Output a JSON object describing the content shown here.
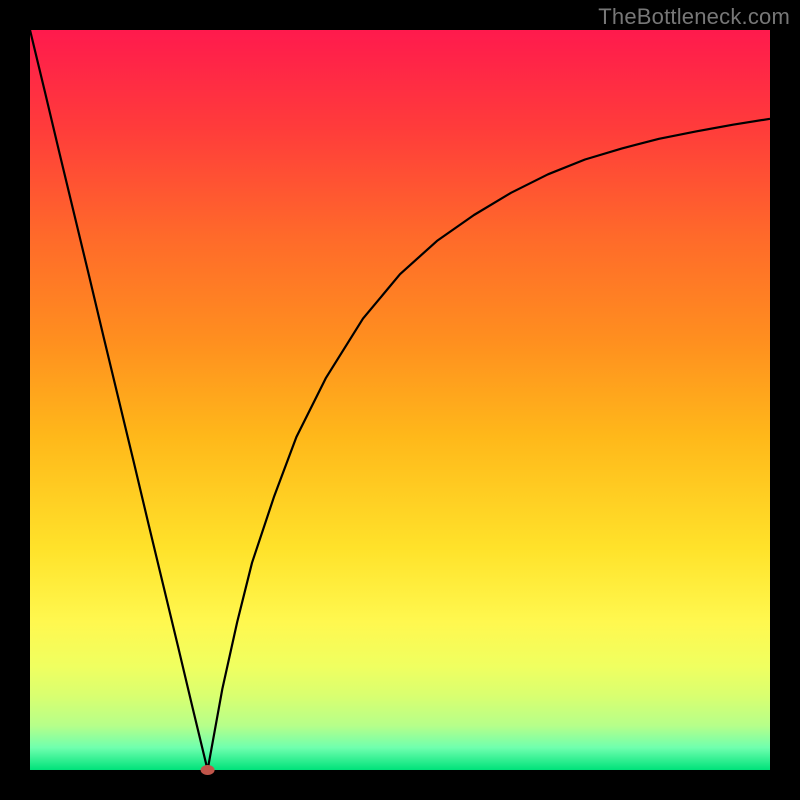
{
  "watermark": "TheBottleneck.com",
  "chart_data": {
    "type": "line",
    "title": "",
    "xlabel": "",
    "ylabel": "",
    "xlim": [
      0,
      100
    ],
    "ylim": [
      0,
      100
    ],
    "grid": false,
    "legend": false,
    "minimum_marker": {
      "x": 24,
      "y": 0,
      "color": "#c0554a"
    },
    "gradient_stops": [
      {
        "pos": 0,
        "color": "#ff1a4d"
      },
      {
        "pos": 13,
        "color": "#ff3b3b"
      },
      {
        "pos": 28,
        "color": "#ff6a2a"
      },
      {
        "pos": 42,
        "color": "#ff8f1f"
      },
      {
        "pos": 55,
        "color": "#ffb81a"
      },
      {
        "pos": 70,
        "color": "#ffe22a"
      },
      {
        "pos": 80,
        "color": "#fff84f"
      },
      {
        "pos": 86,
        "color": "#f0ff60"
      },
      {
        "pos": 90,
        "color": "#d9ff70"
      },
      {
        "pos": 94,
        "color": "#b6ff8a"
      },
      {
        "pos": 97,
        "color": "#6fffae"
      },
      {
        "pos": 100,
        "color": "#00e27a"
      }
    ],
    "series": [
      {
        "name": "left-branch",
        "x": [
          0,
          2,
          4,
          6,
          8,
          10,
          12,
          14,
          16,
          18,
          20,
          22,
          24
        ],
        "y": [
          100,
          91.7,
          83.3,
          75,
          66.7,
          58.3,
          50,
          41.7,
          33.3,
          25,
          16.7,
          8.3,
          0
        ]
      },
      {
        "name": "right-branch",
        "x": [
          24,
          26,
          28,
          30,
          33,
          36,
          40,
          45,
          50,
          55,
          60,
          65,
          70,
          75,
          80,
          85,
          90,
          95,
          100
        ],
        "y": [
          0,
          11,
          20,
          28,
          37,
          45,
          53,
          61,
          67,
          71.5,
          75,
          78,
          80.5,
          82.5,
          84,
          85.3,
          86.3,
          87.2,
          88
        ]
      }
    ]
  }
}
